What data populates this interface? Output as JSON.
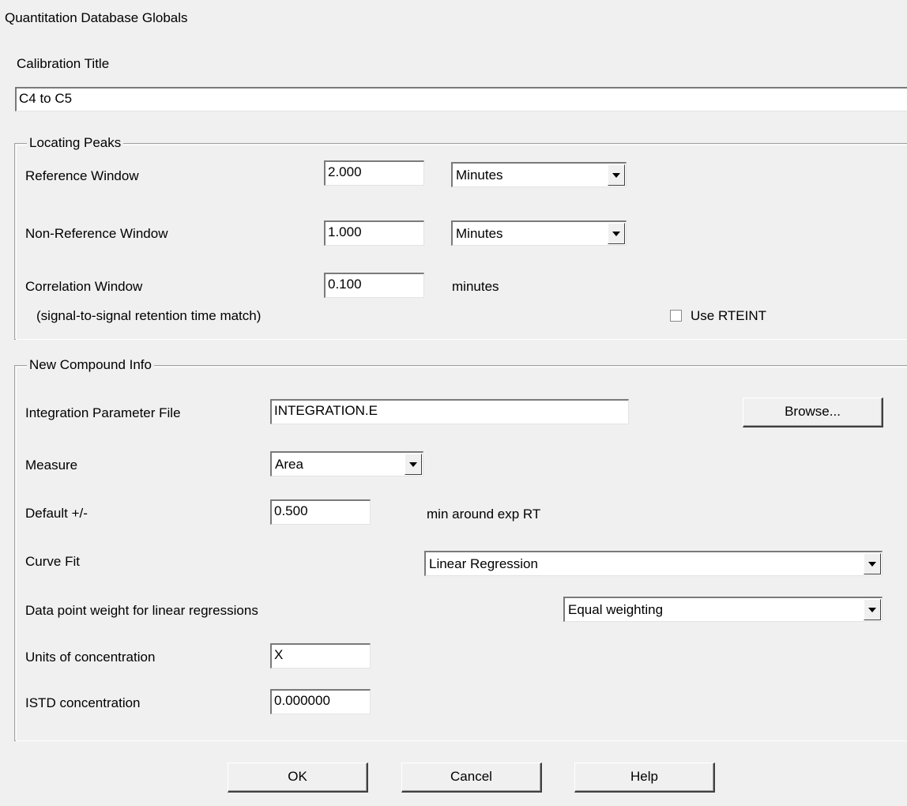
{
  "window": {
    "title": "Quantitation Database Globals"
  },
  "calibration": {
    "label": "Calibration Title",
    "value": "C4 to C5"
  },
  "locating_peaks": {
    "title": "Locating Peaks",
    "reference_window": {
      "label": "Reference Window",
      "value": "2.000",
      "unit": "Minutes"
    },
    "non_reference_window": {
      "label": "Non-Reference Window",
      "value": "1.000",
      "unit": "Minutes"
    },
    "correlation_window": {
      "label": "Correlation Window",
      "value": "0.100",
      "unit": "minutes",
      "note": "(signal-to-signal retention time match)"
    },
    "use_rteint": {
      "label": "Use RTEINT",
      "checked": false
    }
  },
  "new_compound": {
    "title": "New Compound Info",
    "integration_file": {
      "label": "Integration Parameter File",
      "value": "INTEGRATION.E",
      "browse_label": "Browse..."
    },
    "measure": {
      "label": "Measure",
      "value": "Area"
    },
    "default_pm": {
      "label": "Default +/-",
      "value": "0.500",
      "unit": "min around exp RT"
    },
    "curve_fit": {
      "label": "Curve Fit",
      "value": "Linear Regression"
    },
    "weight": {
      "label": "Data point weight for linear regressions",
      "value": "Equal weighting"
    },
    "units": {
      "label": "Units of concentration",
      "value": "X"
    },
    "istd": {
      "label": "ISTD concentration",
      "value": "0.000000"
    }
  },
  "buttons": {
    "ok": "OK",
    "cancel": "Cancel",
    "help": "Help"
  },
  "icons": {
    "dropdown": "chevron-down-icon",
    "checkbox": "checkbox-icon"
  }
}
